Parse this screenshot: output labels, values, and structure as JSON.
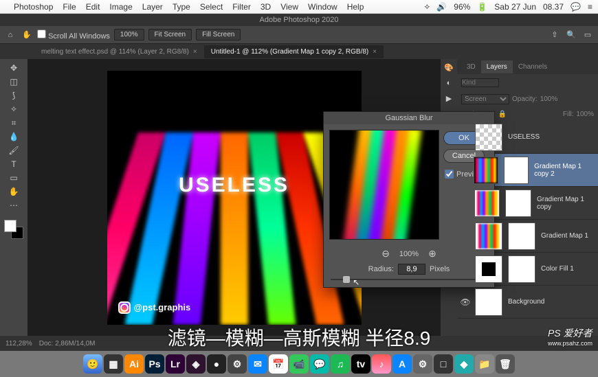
{
  "menubar": {
    "app": "Photoshop",
    "items": [
      "File",
      "Edit",
      "Image",
      "Layer",
      "Type",
      "Select",
      "Filter",
      "3D",
      "View",
      "Window",
      "Help"
    ],
    "battery": "96%",
    "date": "Sab 27 Jun",
    "time": "08.37"
  },
  "app_title": "Adobe Photoshop 2020",
  "optbar": {
    "scroll": "Scroll All Windows",
    "zoom": "100%",
    "fit": "Fit Screen",
    "fill": "Fill Screen"
  },
  "tabs": [
    {
      "label": "melting text effect.psd @ 114% (Layer 2, RG8/8)",
      "active": false
    },
    {
      "label": "Untitled-1 @ 112% (Gradient Map 1 copy 2, RGB/8)",
      "active": true
    }
  ],
  "canvas": {
    "text": "USELESS",
    "handle": "@pst.graphis"
  },
  "dialog": {
    "title": "Gaussian Blur",
    "ok": "OK",
    "cancel": "Cancel",
    "preview_label": "Preview",
    "preview_checked": true,
    "zoom": "100%",
    "radius_label": "Radius:",
    "radius_value": "8,9",
    "radius_unit": "Pixels"
  },
  "panels": {
    "tabs": [
      "3D",
      "Layers",
      "Channels"
    ],
    "active_tab": "Layers",
    "blend": "Screen",
    "opacity_label": "Opacity:",
    "opacity": "100%",
    "lock": "Lock:",
    "fill_label": "Fill:",
    "fill": "100%"
  },
  "layers": [
    {
      "name": "USELESS",
      "thumb": "checker",
      "visible": true
    },
    {
      "name": "Gradient Map 1 copy 2",
      "thumb": "dark",
      "visible": true,
      "selected": true
    },
    {
      "name": "Gradient Map 1 copy",
      "thumb": "stripes",
      "visible": false
    },
    {
      "name": "Gradient Map 1",
      "thumb": "stripes",
      "visible": false
    },
    {
      "name": "Color Fill 1",
      "thumb": "darksmall",
      "visible": true
    },
    {
      "name": "Background",
      "thumb": "white",
      "visible": true
    }
  ],
  "statusbar": {
    "zoom": "112,28%",
    "doc": "Doc: 2,86M/14,0M"
  },
  "subtitle": "滤镜—模糊—高斯模糊 半径8.9",
  "watermark": {
    "brand": "PS 爱好者",
    "url": "www.psahz.com"
  },
  "search_placeholder": "Kind"
}
